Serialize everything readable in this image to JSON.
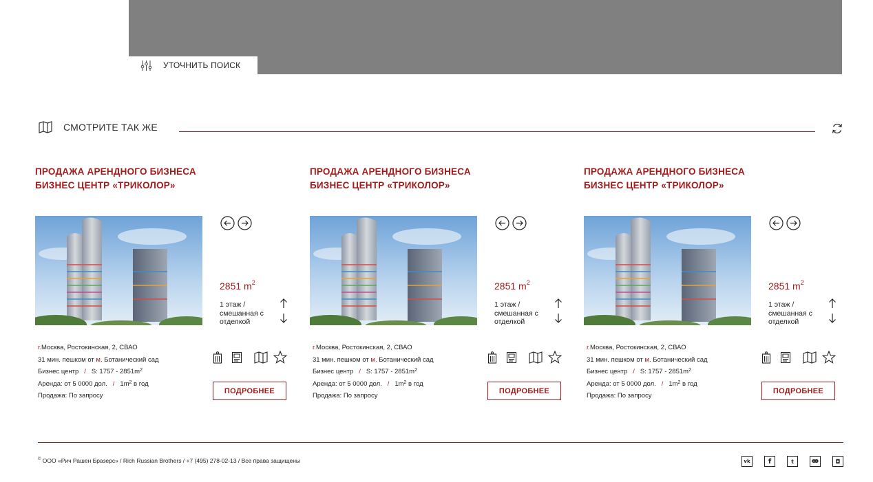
{
  "refine": {
    "label": "УТОЧНИТЬ ПОИСК",
    "icon": "sliders-icon"
  },
  "see_also": {
    "title": "СМОТРИТЕ ТАК ЖЕ",
    "icon": "map-icon",
    "refresh_icon": "refresh-icon"
  },
  "colors": {
    "accent": "#a01c1c",
    "map_placeholder": "#808080"
  },
  "cards": [
    {
      "headline_line1": "ПРОДАЖА АРЕНДНОГО БИЗНЕСА",
      "headline_line2": "БИЗНЕС ЦЕНТР «ТРИКОЛОР»",
      "area": "2851 m",
      "area_sup": "2",
      "floor": "1 этаж   /   смешанная с отделкой",
      "city_prefix": "г.",
      "address": "Москва, Ростокинская, 2, СВАО",
      "walk_text": "31 мин. пешком от ",
      "metro_prefix": "м.",
      "metro": " Ботанический сад",
      "type": "Бизнес центр",
      "sep": "/",
      "size_range": "S: 1757 - 2851m",
      "size_sup": "2",
      "rent": "Аренда: от 5 0000 дол.",
      "rent_unit": "1m",
      "rent_unit_sup": "2",
      "rent_unit_tail": " в год",
      "sale": "Продажа: По запросу",
      "more_label": "ПОДРОБНЕЕ"
    },
    {
      "headline_line1": "ПРОДАЖА АРЕНДНОГО БИЗНЕСА",
      "headline_line2": "БИЗНЕС ЦЕНТР «ТРИКОЛОР»",
      "area": "2851 m",
      "area_sup": "2",
      "floor": "1 этаж   /   смешанная с отделкой",
      "city_prefix": "г.",
      "address": "Москва, Ростокинская, 2, СВАО",
      "walk_text": "31 мин. пешком от ",
      "metro_prefix": "м.",
      "metro": " Ботанический сад",
      "type": "Бизнес центр",
      "sep": "/",
      "size_range": "S: 1757 - 2851m",
      "size_sup": "2",
      "rent": "Аренда: от 5 0000 дол.",
      "rent_unit": "1m",
      "rent_unit_sup": "2",
      "rent_unit_tail": " в год",
      "sale": "Продажа: По запросу",
      "more_label": "ПОДРОБНЕЕ"
    },
    {
      "headline_line1": "ПРОДАЖА АРЕНДНОГО БИЗНЕСА",
      "headline_line2": "БИЗНЕС ЦЕНТР «ТРИКОЛОР»",
      "area": "2851 m",
      "area_sup": "2",
      "floor": "1 этаж   /   смешанная с отделкой",
      "city_prefix": "г.",
      "address": "Москва, Ростокинская, 2, СВАО",
      "walk_text": "31 мин. пешком от ",
      "metro_prefix": "м.",
      "metro": " Ботанический сад",
      "type": "Бизнес центр",
      "sep": "/",
      "size_range": "S: 1757 - 2851m",
      "size_sup": "2",
      "rent": "Аренда: от 5 0000 дол.",
      "rent_unit": "1m",
      "rent_unit_sup": "2",
      "rent_unit_tail": " в год",
      "sale": "Продажа: По запросу",
      "more_label": "ПОДРОБНЕЕ"
    }
  ],
  "footer": {
    "copyright_mark": "©",
    "copyright": " ООО «Рич Рашен Бразерс» / Rich Russian Brothers / +7 (495) 278-02-13 / Все права защищены",
    "socials": [
      "vk-icon",
      "facebook-icon",
      "twitter-icon",
      "odnoklassniki-icon",
      "instagram-icon"
    ]
  }
}
